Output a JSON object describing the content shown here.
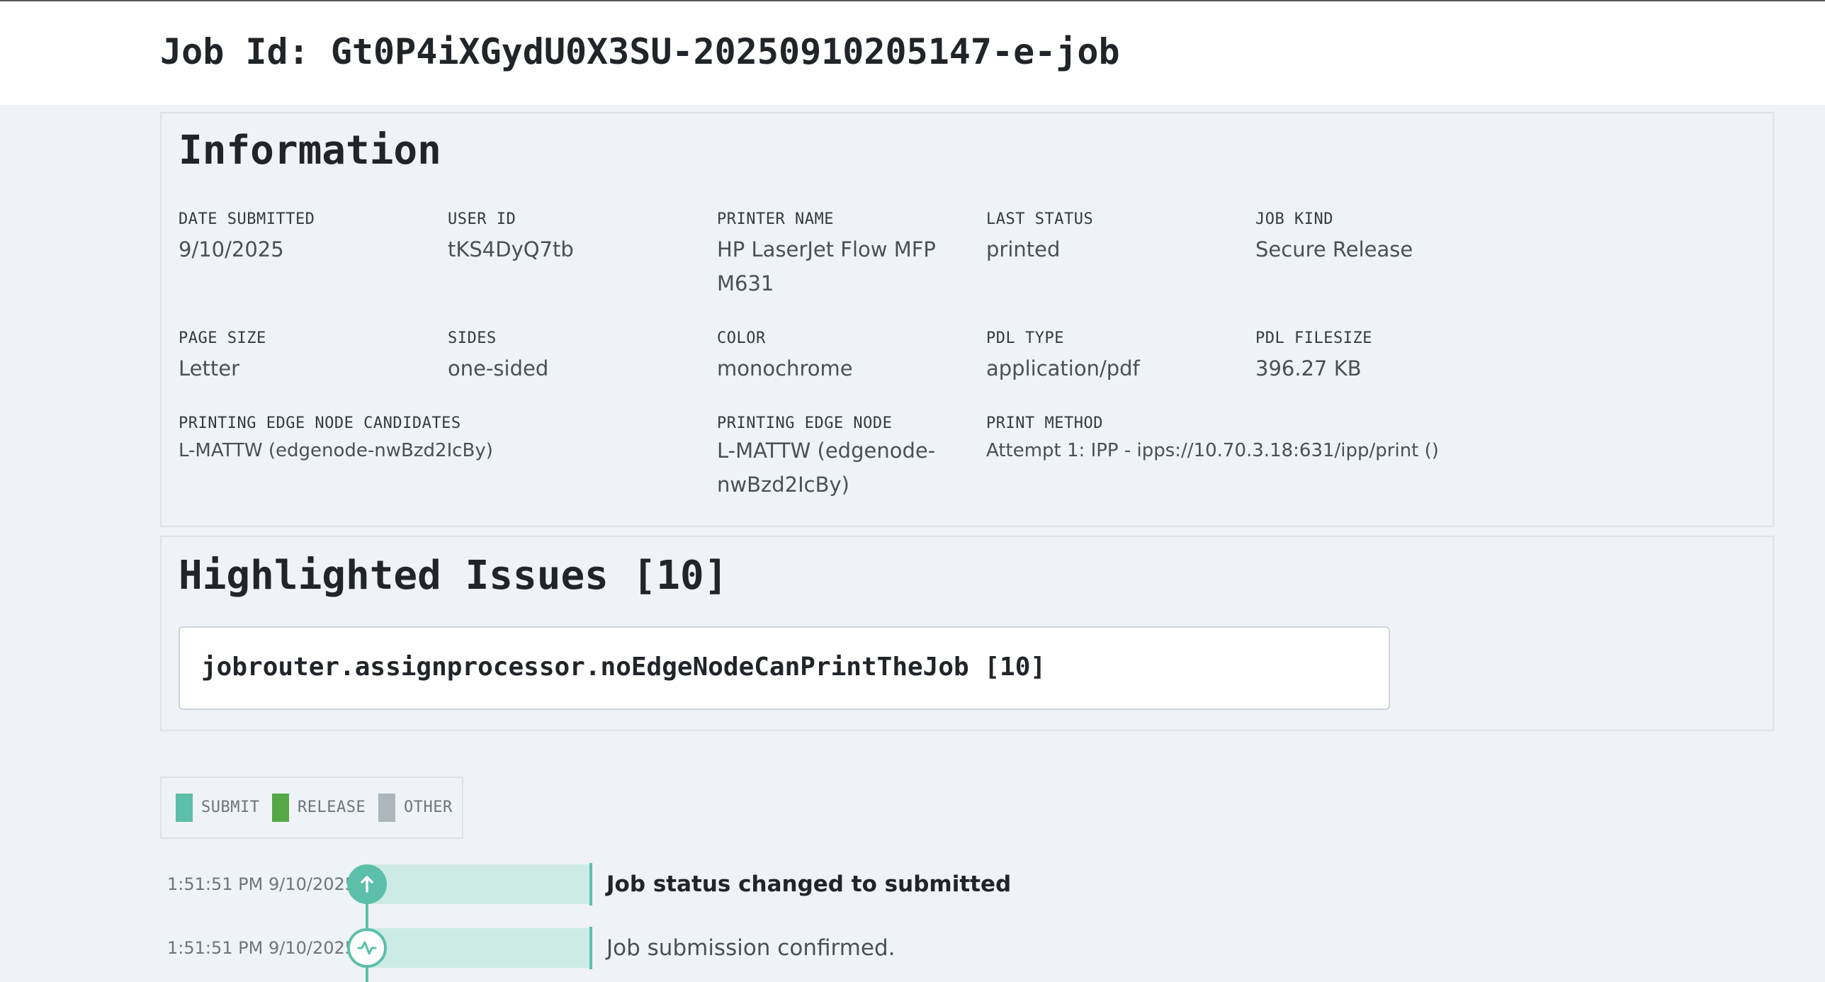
{
  "header": {
    "title": "Job Id: Gt0P4iXGydU0X3SU-20250910205147-e-job"
  },
  "information": {
    "title": "Information",
    "fields": {
      "date_submitted": {
        "label": "DATE SUBMITTED",
        "value": "9/10/2025"
      },
      "user_id": {
        "label": "USER ID",
        "value": "tKS4DyQ7tb"
      },
      "printer_name": {
        "label": "PRINTER NAME",
        "value": "HP LaserJet Flow MFP M631"
      },
      "last_status": {
        "label": "LAST STATUS",
        "value": "printed"
      },
      "job_kind": {
        "label": "JOB KIND",
        "value": "Secure Release"
      },
      "page_size": {
        "label": "PAGE SIZE",
        "value": "Letter"
      },
      "sides": {
        "label": "SIDES",
        "value": "one-sided"
      },
      "color": {
        "label": "COLOR",
        "value": "monochrome"
      },
      "pdl_type": {
        "label": "PDL TYPE",
        "value": "application/pdf"
      },
      "pdl_filesize": {
        "label": "PDL FILESIZE",
        "value": "396.27 KB"
      },
      "edge_node_candidates": {
        "label": "PRINTING EDGE NODE CANDIDATES",
        "value": "L-MATTW (edgenode-nwBzd2IcBy)"
      },
      "edge_node": {
        "label": "PRINTING EDGE NODE",
        "value": "L-MATTW (edgenode-nwBzd2IcBy)"
      },
      "print_method": {
        "label": "PRINT METHOD",
        "value": "Attempt 1: IPP - ipps://10.70.3.18:631/ipp/print ()"
      }
    }
  },
  "issues": {
    "title": "Highlighted Issues [10]",
    "items": [
      {
        "text": "jobrouter.assignprocessor.noEdgeNodeCanPrintTheJob [10]"
      }
    ]
  },
  "legend": {
    "items": [
      {
        "label": "SUBMIT",
        "color": "#5cbfa9"
      },
      {
        "label": "RELEASE",
        "color": "#56a847"
      },
      {
        "label": "OTHER",
        "color": "#adb5bd"
      }
    ]
  },
  "timeline": {
    "accent_color": "#5cbfa9",
    "events": [
      {
        "time": "1:51:51 PM 9/10/2025",
        "message": "Job status changed to submitted",
        "icon": "arrow-up-icon"
      },
      {
        "time": "1:51:51 PM 9/10/2025",
        "message": "Job submission confirmed.",
        "icon": "activity-icon"
      }
    ]
  }
}
